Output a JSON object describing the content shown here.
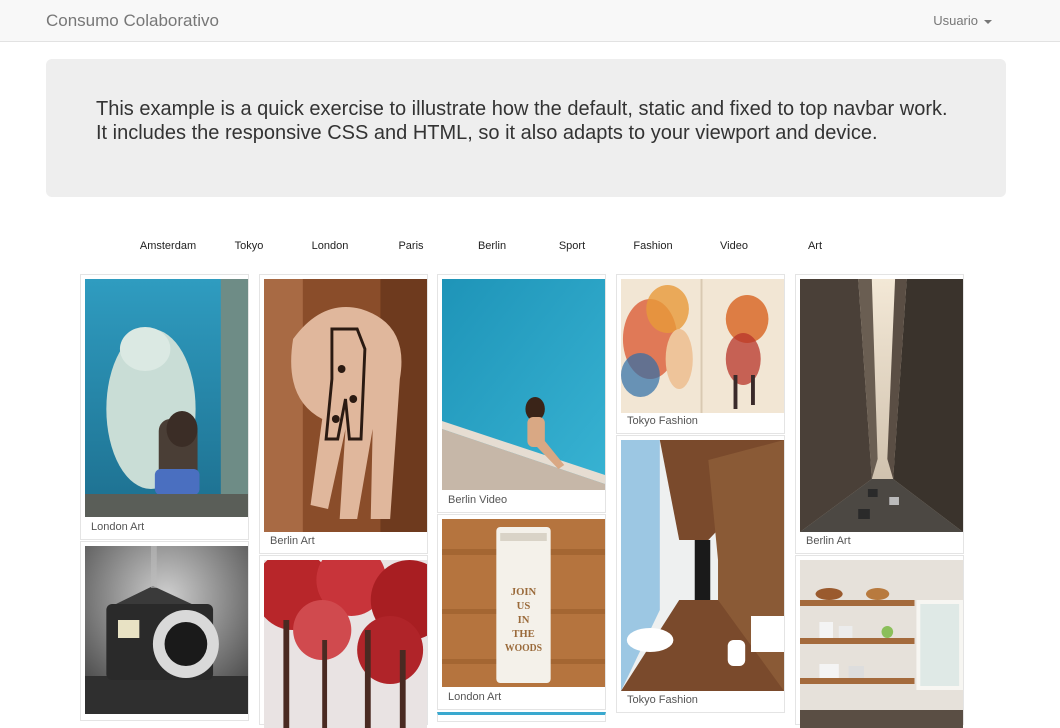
{
  "navbar": {
    "brand": "Consumo Colaborativo",
    "user_menu_label": "Usuario"
  },
  "jumbotron": {
    "text": "This example is a quick exercise to illustrate how the default, static and fixed to top navbar work. It includes the responsive CSS and HTML, so it also adapts to your viewport and device."
  },
  "filters": [
    "Amsterdam",
    "Tokyo",
    "London",
    "Paris",
    "Berlin",
    "Sport",
    "Fashion",
    "Video",
    "Art"
  ],
  "cards": [
    {
      "caption": "London Art",
      "image": "polar-bear-and-child"
    },
    {
      "caption": "Berlin Art",
      "image": "giraffe-drawn-on-hand"
    },
    {
      "caption": "Berlin Video",
      "image": "girl-by-blue-pool"
    },
    {
      "caption": "Tokyo Fashion",
      "image": "watercolor-girl-illustration"
    },
    {
      "caption": "Berlin Art",
      "image": "city-street-skyscrapers"
    },
    {
      "caption": "",
      "image": "surreal-camera-house"
    },
    {
      "caption": "",
      "image": "red-autumn-trees"
    },
    {
      "caption": "London Art",
      "image": "wooden-invitation-card"
    },
    {
      "caption": "Tokyo Fashion",
      "image": "wooden-bathroom"
    },
    {
      "caption": "",
      "image": "kitchen-shelves"
    }
  ],
  "invitation_text": [
    "JOIN",
    "US",
    "IN",
    "THE",
    "WOODS"
  ]
}
